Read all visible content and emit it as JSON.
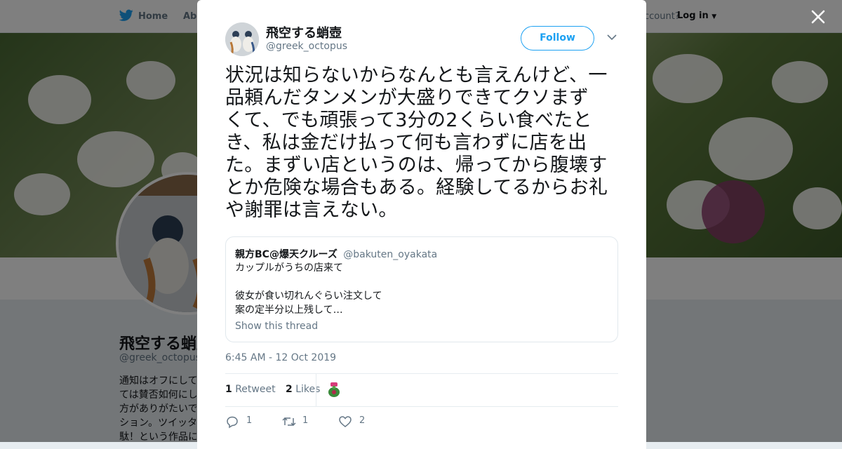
{
  "topbar": {
    "home_label": "Home",
    "about_label": "Abo",
    "account_question": "ccount?",
    "login_label": "Log in"
  },
  "profile": {
    "name": "飛空する蛸壺",
    "handle": "@greek_octopus",
    "bio_lines": [
      "通知はオフにして",
      "ては賛否如何にし",
      "方がありがたいで",
      "ション。ツイッタ",
      "駄！という作品に"
    ]
  },
  "tweet": {
    "author_name": "飛空する蛸壺",
    "author_handle": "@greek_octopus",
    "follow_label": "Follow",
    "text_lines": [
      "状況は知らないからなんとも言えんけど、一",
      "品頼んだタンメンが大盛りできてクソまず",
      "くて、でも頑張って3分の2くらい食べたと",
      "き、私は金だけ払って何も言わずに店を出",
      "た。まずい店というのは、帰ってから腹壊す",
      "とか危険な場合もある。経験してるからお礼",
      "や謝罪は言えない。"
    ],
    "quoted": {
      "name": "親方BC@爆天クルーズ",
      "handle": "@bakuten_oyakata",
      "lines": [
        "カップルがうちの店来て",
        "",
        "彼女が食い切れんぐらい注文して",
        "案の定半分以上残して…"
      ],
      "show_thread_label": "Show this thread"
    },
    "timestamp": "6:45 AM - 12 Oct 2019",
    "retweet_count": "1",
    "retweet_label": "Retweet",
    "like_count": "2",
    "like_label": "Likes",
    "actions": {
      "reply_count": "1",
      "retweet_count": "1",
      "like_count": "2"
    }
  },
  "colors": {
    "accent": "#1da1f2",
    "text": "#14171a",
    "muted": "#657786",
    "border": "#e1e8ed"
  }
}
